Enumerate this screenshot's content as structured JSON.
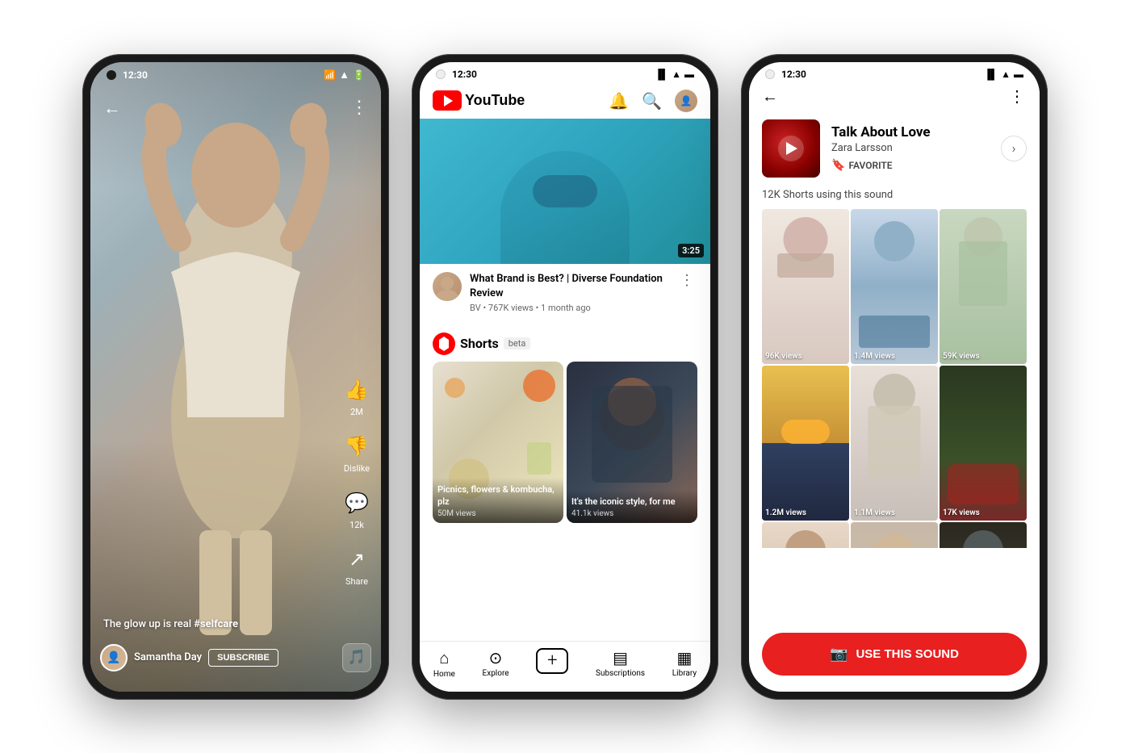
{
  "phones": {
    "phone1": {
      "status": {
        "time": "12:30",
        "icons": [
          "signal",
          "wifi",
          "battery"
        ]
      },
      "caption": "The glow up is real ",
      "hashtag": "#selfcare",
      "channel": "Samantha Day",
      "subscribe": "SUBSCRIBE",
      "actions": {
        "likes": "2M",
        "dislike_label": "Dislike",
        "comments": "12k",
        "share_label": "Share"
      }
    },
    "phone2": {
      "status": {
        "time": "12:30"
      },
      "header": {
        "logo_text": "YouTube"
      },
      "video": {
        "title": "What Brand is Best? | Diverse Foundation Review",
        "channel": "BV",
        "views": "767K views",
        "time_ago": "1 month ago",
        "duration": "3:25"
      },
      "shorts": {
        "label": "Shorts",
        "beta": "beta",
        "items": [
          {
            "title": "Picnics, flowers & kombucha, plz",
            "views": "50M views"
          },
          {
            "title": "It's the iconic style, for me",
            "views": "41.1k views"
          }
        ]
      },
      "nav": {
        "items": [
          "Home",
          "Explore",
          "",
          "Subscriptions",
          "Library"
        ]
      }
    },
    "phone3": {
      "status": {
        "time": "12:30"
      },
      "sound": {
        "title": "Talk About Love",
        "artist": "Zara Larsson",
        "favorite": "FAVORITE",
        "count_label": "12K Shorts using this sound"
      },
      "videos": [
        {
          "views": "96K views"
        },
        {
          "views": "1.4M views"
        },
        {
          "views": "59K views"
        },
        {
          "views": "1.2M views"
        },
        {
          "views": "1.1M views"
        },
        {
          "views": "17K views"
        },
        {
          "views": ""
        },
        {
          "views": ""
        },
        {
          "views": ""
        }
      ],
      "use_sound_btn": "USE THIS SOUND"
    }
  }
}
